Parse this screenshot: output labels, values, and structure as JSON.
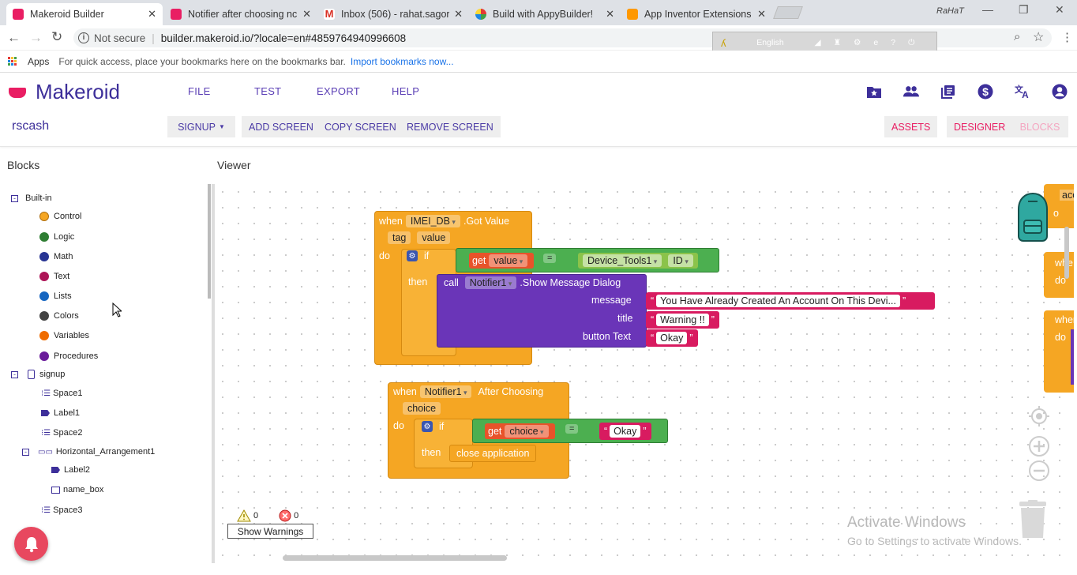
{
  "browser": {
    "tabs": [
      {
        "title": "Makeroid Builder",
        "color": "#e91e63",
        "active": true
      },
      {
        "title": "Notifier after choosing nc",
        "color": "#e91e63",
        "active": false
      },
      {
        "title": "Inbox (506) - rahat.sagor",
        "color": "#d93025",
        "active": false
      },
      {
        "title": "Build with AppyBuilder!",
        "color": "#4caf50",
        "active": false
      },
      {
        "title": "App Inventor Extensions",
        "color": "#ff9800",
        "active": false
      }
    ],
    "profile": "RaHaT",
    "address_security": "Not secure",
    "address_url": "builder.makeroid.io/?locale=en#4859764940996608",
    "ext_language": "English",
    "bookmarks_apps": "Apps",
    "bookmarks_hint": "For quick access, place your bookmarks here on the bookmarks bar.",
    "bookmarks_import": "Import bookmarks now..."
  },
  "app": {
    "logo": "Makeroid",
    "menu": [
      "FILE",
      "TEST",
      "EXPORT",
      "HELP"
    ],
    "project": "rscash",
    "screen_select": "SIGNUP",
    "screen_buttons": [
      "ADD SCREEN",
      "COPY SCREEN",
      "REMOVE SCREEN"
    ],
    "right_buttons": [
      "ASSETS",
      "DESIGNER",
      "BLOCKS"
    ],
    "accent": "#e91e63",
    "brand": "#3d2f9a"
  },
  "blocks_panel": {
    "title": "Blocks",
    "builtin": "Built-in",
    "categories": [
      {
        "label": "Control",
        "color": "#f5a623"
      },
      {
        "label": "Logic",
        "color": "#2e7d32"
      },
      {
        "label": "Math",
        "color": "#283593"
      },
      {
        "label": "Text",
        "color": "#ad1457"
      },
      {
        "label": "Lists",
        "color": "#1565c0"
      },
      {
        "label": "Colors",
        "color": "#424242"
      },
      {
        "label": "Variables",
        "color": "#ef6c00"
      },
      {
        "label": "Procedures",
        "color": "#6a1b9a"
      }
    ],
    "screen": "signup",
    "components": [
      "Space1",
      "Label1",
      "Space2",
      "Horizontal_Arrangement1",
      "Label2",
      "name_box",
      "Space3"
    ]
  },
  "viewer": {
    "title": "Viewer",
    "warnings_count": "0",
    "errors_count": "0",
    "show_warnings": "Show Warnings",
    "watermark_title": "Activate Windows",
    "watermark_sub": "Go to Settings to activate Windows."
  },
  "block1": {
    "when": "when",
    "component": "IMEI_DB",
    "event": ".Got Value",
    "param1": "tag",
    "param2": "value",
    "do": "do",
    "if": "if",
    "get": "get",
    "get_var": "value",
    "op": "=",
    "cmp_comp": "Device_Tools1",
    "cmp_prop": "ID",
    "then": "then",
    "call": "call",
    "notifier": "Notifier1",
    "method": ".Show Message Dialog",
    "arg_message": "message",
    "msg_value": "You Have Already Created An Account On This Devi...",
    "arg_title": "title",
    "title_value": "Warning !!",
    "arg_button": "button Text",
    "button_value": "Okay"
  },
  "block2": {
    "when": "when",
    "component": "Notifier1",
    "event": "After Choosing",
    "param": "choice",
    "do": "do",
    "if": "if",
    "get": "get",
    "get_var": "choice",
    "op": "=",
    "cmp_value": "Okay",
    "then": "then",
    "action": "close application"
  },
  "offscreen_blocks": [
    "acc",
    "o",
    "whe",
    "do",
    "when",
    "do"
  ]
}
